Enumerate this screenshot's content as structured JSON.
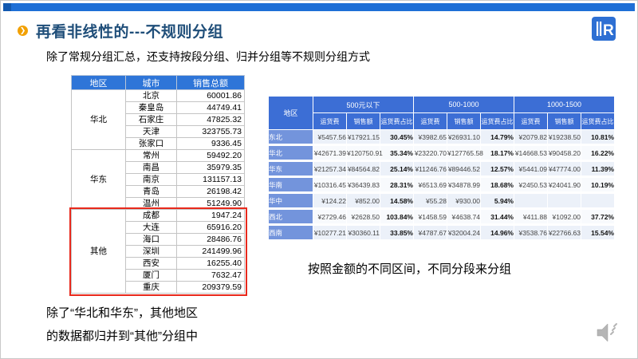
{
  "slide": {
    "title": "再看非线性的---不规则分组",
    "subtitle": "除了常规分组汇总，还支持按段分组、归并分组等不规则分组方式",
    "caption_right": "按照金额的不同区间，不同分段来分组",
    "caption_left_line1": "除了“华北和华东”，其他地区",
    "caption_left_line2": "的数据都归并到“其他”分组中"
  },
  "colors": {
    "top_bar": "#1e6fd6",
    "title_text": "#1f4e79",
    "bullet_orange": "#f2a104",
    "left_table_header": "#2e75d8",
    "right_table_header": "#3c6ed5",
    "right_region_cell": "#7394dc",
    "highlight_border": "#e8291c"
  },
  "icons": {
    "bullet": "chevron-right-icon",
    "bullet_glyph": "❯",
    "logo": "brand-logo-icon",
    "speaker": "audio-speaker-icon"
  },
  "left_table": {
    "headers": [
      "地区",
      "城市",
      "销售总额"
    ],
    "groups": [
      {
        "region": "华北",
        "highlighted": false,
        "rows": [
          [
            "北京",
            "60001.86"
          ],
          [
            "秦皇岛",
            "44749.41"
          ],
          [
            "石家庄",
            "47825.32"
          ],
          [
            "天津",
            "323755.73"
          ],
          [
            "张家口",
            "9336.45"
          ]
        ]
      },
      {
        "region": "华东",
        "highlighted": false,
        "rows": [
          [
            "常州",
            "59492.20"
          ],
          [
            "南昌",
            "35979.35"
          ],
          [
            "南京",
            "131157.13"
          ],
          [
            "青岛",
            "26198.42"
          ],
          [
            "温州",
            "51249.90"
          ]
        ]
      },
      {
        "region": "其他",
        "highlighted": true,
        "rows": [
          [
            "成都",
            "1947.24"
          ],
          [
            "大连",
            "65916.20"
          ],
          [
            "海口",
            "28486.76"
          ],
          [
            "深圳",
            "241499.96"
          ],
          [
            "西安",
            "16255.40"
          ],
          [
            "厦门",
            "7632.47"
          ],
          [
            "重庆",
            "209379.59"
          ]
        ]
      }
    ]
  },
  "right_table": {
    "region_header": "地区",
    "col_groups": [
      {
        "label": "500元以下",
        "cols": [
          "运货费",
          "销售额",
          "运货费占比"
        ]
      },
      {
        "label": "500-1000",
        "cols": [
          "运货费",
          "销售额",
          "运货费占比"
        ]
      },
      {
        "label": "1000-1500",
        "cols": [
          "运货费",
          "销售额",
          "运货费占比"
        ]
      }
    ],
    "rows": [
      {
        "region": "东北",
        "values": [
          "¥5457.56",
          "¥17921.15",
          "30.45%",
          "¥3982.65",
          "¥26931.10",
          "14.79%",
          "¥2079.82",
          "¥19238.50",
          "10.81%"
        ]
      },
      {
        "region": "华北",
        "values": [
          "¥42671.39",
          "¥120750.91",
          "35.34%",
          "¥23220.70",
          "¥127765.58",
          "18.17%",
          "¥14668.53",
          "¥90458.20",
          "16.22%"
        ]
      },
      {
        "region": "华东",
        "values": [
          "¥21257.34",
          "¥84564.82",
          "25.14%",
          "¥11246.76",
          "¥89446.52",
          "12.57%",
          "¥5441.09",
          "¥47774.00",
          "11.39%"
        ]
      },
      {
        "region": "华南",
        "values": [
          "¥10316.45",
          "¥36439.83",
          "28.31%",
          "¥6513.69",
          "¥34878.99",
          "18.68%",
          "¥2450.53",
          "¥24041.90",
          "10.19%"
        ]
      },
      {
        "region": "华中",
        "values": [
          "¥124.22",
          "¥852.00",
          "14.58%",
          "¥55.28",
          "¥930.00",
          "5.94%",
          "",
          "",
          ""
        ]
      },
      {
        "region": "西北",
        "values": [
          "¥2729.46",
          "¥2628.50",
          "103.84%",
          "¥1458.59",
          "¥4638.74",
          "31.44%",
          "¥411.88",
          "¥1092.00",
          "37.72%"
        ]
      },
      {
        "region": "西南",
        "values": [
          "¥10277.21",
          "¥30360.11",
          "33.85%",
          "¥4787.67",
          "¥32004.24",
          "14.96%",
          "¥3538.76",
          "¥22766.63",
          "15.54%"
        ]
      }
    ]
  }
}
